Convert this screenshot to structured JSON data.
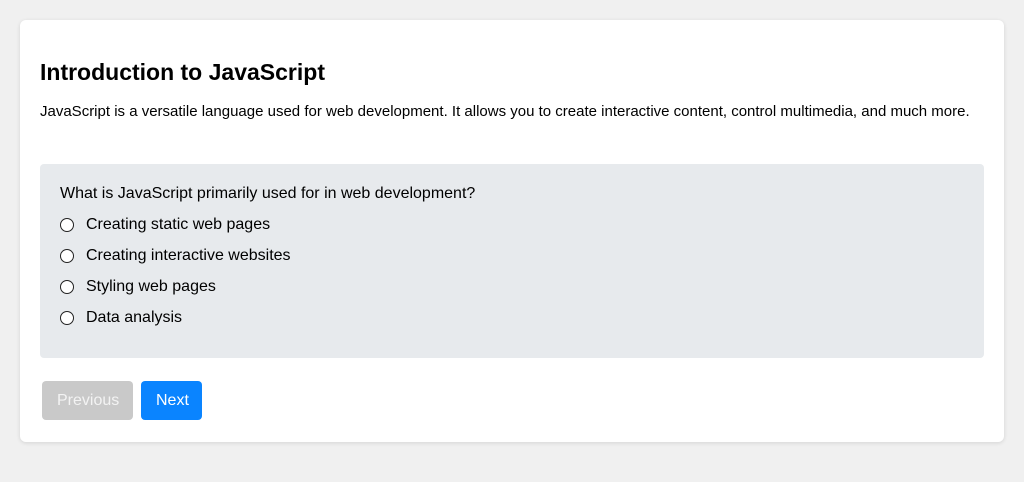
{
  "lesson": {
    "title": "Introduction to JavaScript",
    "description": "JavaScript is a versatile language used for web development. It allows you to create interactive content, control multimedia, and much more."
  },
  "quiz": {
    "question": "What is JavaScript primarily used for in web development?",
    "options": [
      {
        "label": "Creating static web pages",
        "selected": false
      },
      {
        "label": "Creating interactive websites",
        "selected": false
      },
      {
        "label": "Styling web pages",
        "selected": false
      },
      {
        "label": "Data analysis",
        "selected": false
      }
    ]
  },
  "navigation": {
    "previous_label": "Previous",
    "next_label": "Next",
    "previous_disabled": true
  },
  "colors": {
    "page_background": "#f0f0f0",
    "quiz_background": "#e7eaed",
    "primary_button": "#0a84ff",
    "disabled_button": "#c9c9c9"
  }
}
